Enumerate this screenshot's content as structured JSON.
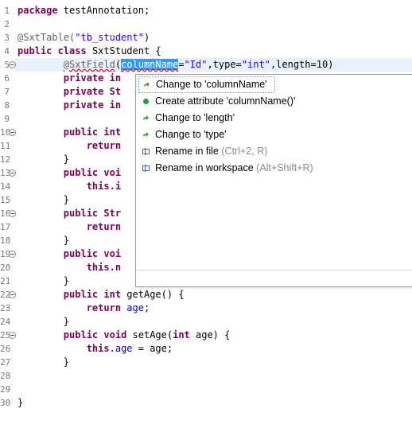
{
  "editor": {
    "line_numbers": [
      "1",
      "2",
      "3",
      "4",
      "5",
      "6",
      "7",
      "8",
      "9",
      "10",
      "11",
      "12",
      "13",
      "14",
      "15",
      "16",
      "17",
      "18",
      "19",
      "20",
      "21",
      "22",
      "23",
      "24",
      "25",
      "26",
      "27",
      "28",
      "29",
      "30"
    ],
    "fold_markers": [
      "10",
      "13",
      "16",
      "19",
      "22",
      "25"
    ],
    "lines": {
      "l1_kw": "package",
      "l1_rest": " testAnnotation;",
      "l3_anno": "@SxtTable(",
      "l3_str": "\"tb_student\"",
      "l3_end": ")",
      "l4_kw1": "public",
      "l4_kw2": "class",
      "l4_rest": " SxtStudent {",
      "l5_anno": "@SxtField",
      "l5_paren": "(",
      "l5_sel": "columnName",
      "l5_eq": "=",
      "l5_str1": "\"Id\"",
      "l5_mid": ",type=",
      "l5_str2": "\"int\"",
      "l5_end": ",length=10)",
      "l6": "private in",
      "l7": "private St",
      "l8": "private in",
      "l10": "public int",
      "l11": "return",
      "l12": "}",
      "l13": "public voi",
      "l14": "this.i",
      "l15": "}",
      "l16": "public Str",
      "l17": "return",
      "l18": "}",
      "l19": "public voi",
      "l20": "this.n",
      "l21": "}",
      "l22_kw1": "public",
      "l22_kw2": "int",
      "l22_rest": " getAge() {",
      "l23_kw": "return",
      "l23_fld": "age",
      "l23_end": ";",
      "l24": "}",
      "l25_kw1": "public",
      "l25_kw2": "void",
      "l25_mid": " setAge(",
      "l25_kw3": "int",
      "l25_end": " age) {",
      "l26_kw": "this",
      "l26_dot": ".",
      "l26_fld": "age",
      "l26_end": " = age;",
      "l27": "}",
      "l30": "}"
    }
  },
  "quickfix": {
    "items": [
      {
        "label": "Change to 'columnName'",
        "icon": "change-arrow-icon"
      },
      {
        "label": "Create attribute 'columnName()'",
        "icon": "green-dot-icon"
      },
      {
        "label": "Change to 'length'",
        "icon": "change-arrow-icon"
      },
      {
        "label": "Change to 'type'",
        "icon": "change-arrow-icon"
      },
      {
        "label": "Rename in file",
        "shortcut": "(Ctrl+2, R)",
        "icon": "rename-icon"
      },
      {
        "label": "Rename in workspace",
        "shortcut": "(Alt+Shift+R)",
        "icon": "rename-icon"
      }
    ]
  },
  "colors": {
    "keyword": "#7f0055",
    "string": "#2a00ff",
    "field": "#0000c0",
    "annotation": "#646464",
    "selection": "#3399ff",
    "current_line": "#e8f2fe"
  }
}
